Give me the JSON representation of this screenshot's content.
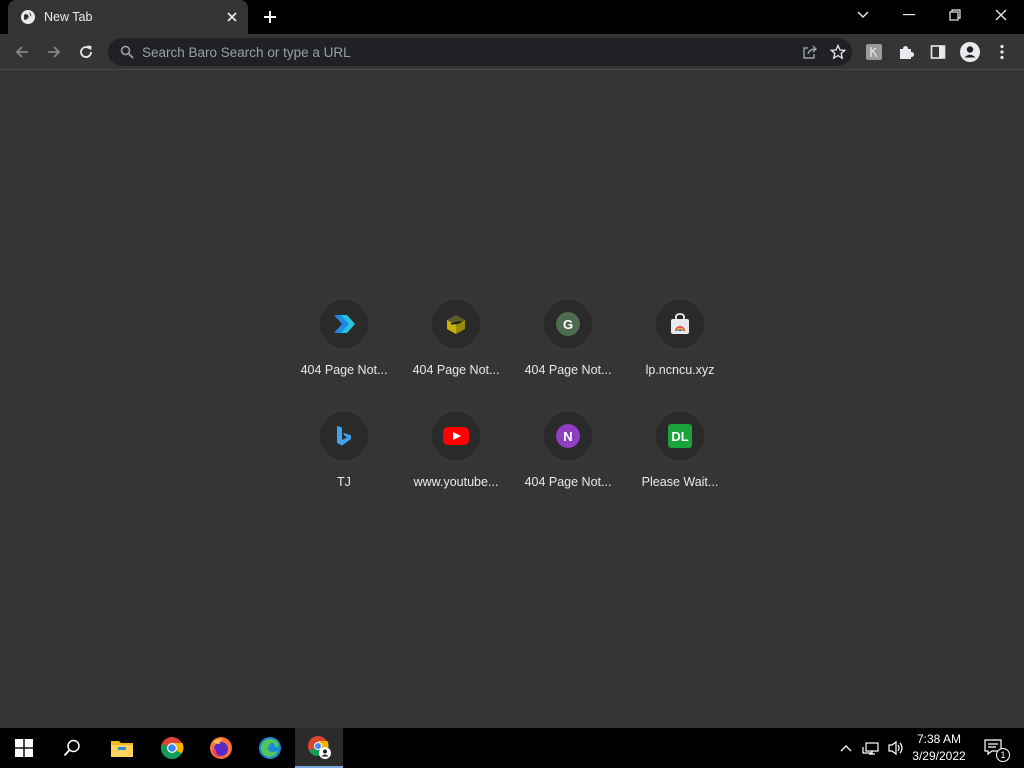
{
  "window": {
    "tab_title": "New Tab"
  },
  "omnibox": {
    "placeholder": "Search Baro Search or type a URL"
  },
  "shortcuts": [
    {
      "title": "404 Page Not...",
      "icon": "chevron-arrow-icon",
      "badge": ""
    },
    {
      "title": "404 Page Not...",
      "icon": "cube-icon",
      "badge": ""
    },
    {
      "title": "404 Page Not...",
      "icon": "letter-g-icon",
      "badge": "G"
    },
    {
      "title": "lp.ncncu.xyz",
      "icon": "shopping-bag-icon",
      "badge": ""
    },
    {
      "title": "TJ",
      "icon": "bing-icon",
      "badge": ""
    },
    {
      "title": "www.youtube...",
      "icon": "youtube-icon",
      "badge": ""
    },
    {
      "title": "404 Page Not...",
      "icon": "letter-n-icon",
      "badge": "N"
    },
    {
      "title": "Please Wait...",
      "icon": "dl-icon",
      "badge": "DL"
    }
  ],
  "taskbar": {
    "time": "7:38 AM",
    "date": "3/29/2022",
    "notification_count": "1"
  },
  "colors": {
    "page_background": "#353535",
    "titlebar": "#000000",
    "omnibox_background": "#202124",
    "text_primary": "#e8eaed"
  }
}
